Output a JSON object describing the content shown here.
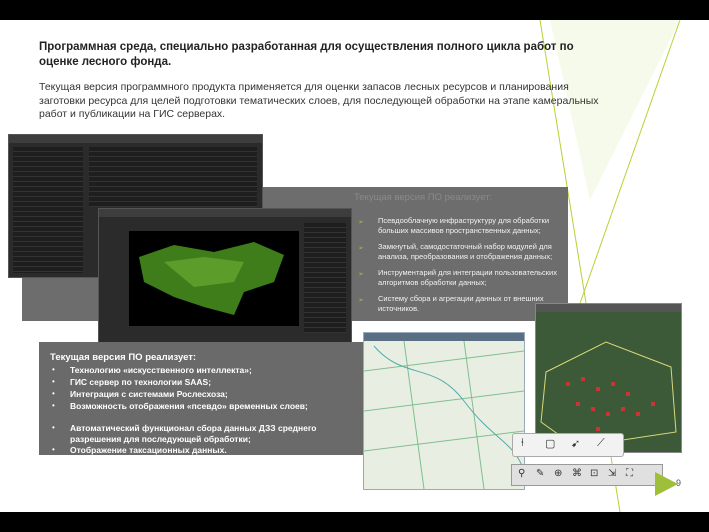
{
  "intro": {
    "bold": "Программная среда, специально разработанная для осуществления полного цикла работ по оценке лесного фонда.",
    "text": "Текущая версия программного продукта применяется для оценки запасов лесных ресурсов и планирования заготовки ресурса для целей подготовки тематических слоев, для последующей обработки на этапе камеральных работ и публикации на ГИС серверах."
  },
  "right_panel": {
    "title": "Текущая версия ПО реализует:",
    "items": [
      "Псевдооблачную инфраструктуру для обработки больших массивов пространственных данных;",
      "Замкнутый, самодостаточный набор модулей для анализа, преобразования и отображения данных;",
      "Инструментарий для интеграции пользовательских алгоритмов обработки данных;",
      "Систему сбора и агрегации данных от внешних источников."
    ]
  },
  "left_panel": {
    "title": "Текущая версия ПО реализует:",
    "items": [
      "Технологию «искусственного интеллекта»;",
      "ГИС сервер по технологии SAAS;",
      "Интеграция с системами Рослесхоза;",
      "Возможность отображения «псевдо» временных слоев;",
      "Автоматический функционал сбора данных ДЗЗ среднего разрешения для последующей обработки;",
      "Отображение таксационных данных."
    ]
  },
  "page_number": "9",
  "colors": {
    "accent": "#9fbf3b",
    "panel": "#6a6a6a",
    "map_green": "#4a8a1e"
  }
}
